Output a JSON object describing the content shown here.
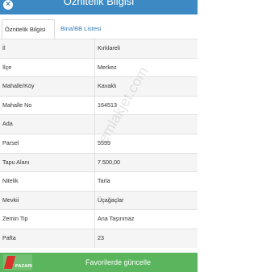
{
  "header": {
    "title": "Öznitelik Bilgisi",
    "close_glyph": "×"
  },
  "tabs": [
    {
      "label": "Öznitelik Bilgisi",
      "active": true
    },
    {
      "label": "Bina/BB Listesi",
      "active": false
    }
  ],
  "rows": [
    {
      "key": "İl",
      "value": "Kırklareli"
    },
    {
      "key": "İlçe",
      "value": "Merkez"
    },
    {
      "key": "Mahalle/Köy",
      "value": "Kavaklı"
    },
    {
      "key": "Mahalle No",
      "value": "164513"
    },
    {
      "key": "Ada",
      "value": ""
    },
    {
      "key": "Parsel",
      "value": "5599"
    },
    {
      "key": "Tapu Alanı",
      "value": "7.500,00"
    },
    {
      "key": "Nitelik",
      "value": "Tarla"
    },
    {
      "key": "Mevkii",
      "value": "Üçağaçlar"
    },
    {
      "key": "Zemin Tip",
      "value": "Ana Taşınmaz"
    },
    {
      "key": "Pafta",
      "value": "23"
    }
  ],
  "watermark": "emlakjet.com",
  "footer": {
    "logo_text": "PAZARI",
    "button_label": "Favorilerde güncelle"
  },
  "colors": {
    "header": "#3c89c4",
    "footer": "#5bb55d",
    "link": "#337ab7"
  }
}
